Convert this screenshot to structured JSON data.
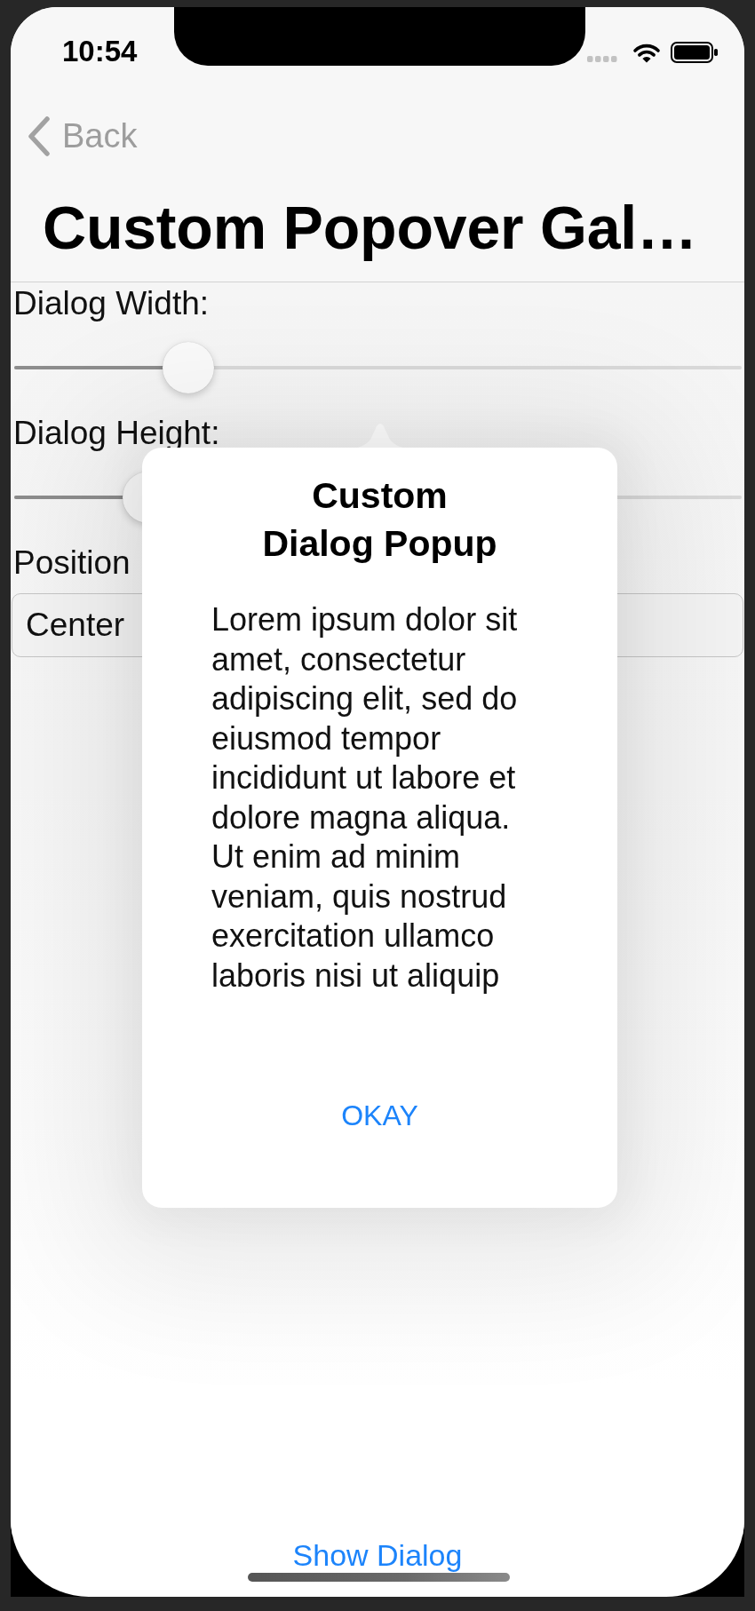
{
  "status_bar": {
    "time": "10:54"
  },
  "nav_bar": {
    "back_label": "Back",
    "title": "Custom Popover Gal…"
  },
  "form": [
    {
      "kind": "label",
      "text": "Dialog Width:"
    },
    {
      "kind": "slider",
      "level": 0.22
    },
    {
      "kind": "label",
      "text": "Dialog Height:"
    },
    {
      "kind": "slider",
      "level": 0.16
    },
    {
      "kind": "label",
      "text": "Position"
    },
    {
      "kind": "field",
      "value": "Center"
    }
  ],
  "popover": {
    "title": "Custom Dialog Popup",
    "body": "Lorem ipsum dolor sit amet, consectetur adipiscing elit, sed do eiusmod tempor incididunt ut labore et dolore magna aliqua. Ut enim ad minim veniam, quis nostrud exercitation ullamco laboris nisi ut aliquip",
    "button": "OKAY"
  },
  "bottom_button": "Show Dialog"
}
